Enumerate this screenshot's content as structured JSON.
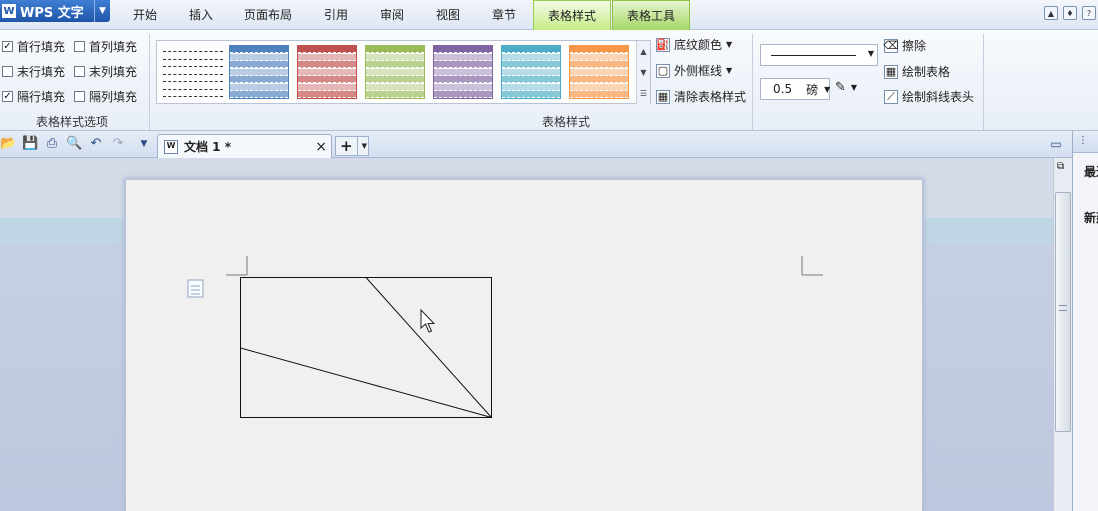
{
  "app": {
    "title": "WPS 文字"
  },
  "menu": {
    "tabs": [
      "开始",
      "插入",
      "页面布局",
      "引用",
      "审阅",
      "视图",
      "章节",
      "表格样式",
      "表格工具"
    ],
    "active_tab": "表格样式"
  },
  "ribbon": {
    "options_group": {
      "label": "表格样式选项",
      "checkboxes": [
        {
          "label": "首行填充",
          "checked": true
        },
        {
          "label": "首列填充",
          "checked": false
        },
        {
          "label": "末行填充",
          "checked": false
        },
        {
          "label": "末列填充",
          "checked": false
        },
        {
          "label": "隔行填充",
          "checked": true
        },
        {
          "label": "隔列填充",
          "checked": false
        }
      ]
    },
    "styles_group": {
      "label": "表格样式",
      "colors": [
        "#ffffff",
        "#4f81bd",
        "#c0504d",
        "#9bbb59",
        "#8064a2",
        "#4bacc6",
        "#f79646"
      ],
      "shading_label": "底纹颜色",
      "border_label": "外侧框线",
      "clear_label": "清除表格样式"
    },
    "draw_group": {
      "line_weight_value": "0.5",
      "line_weight_unit": "磅",
      "erase_label": "擦除",
      "draw_table_label": "绘制表格",
      "draw_diagonal_label": "绘制斜线表头"
    }
  },
  "tabbar": {
    "doc_tab_title": "文档 1 *",
    "close_glyph": "×",
    "new_tab_glyph": "+"
  },
  "taskpane": {
    "line1": "最近",
    "line2": "新建"
  }
}
